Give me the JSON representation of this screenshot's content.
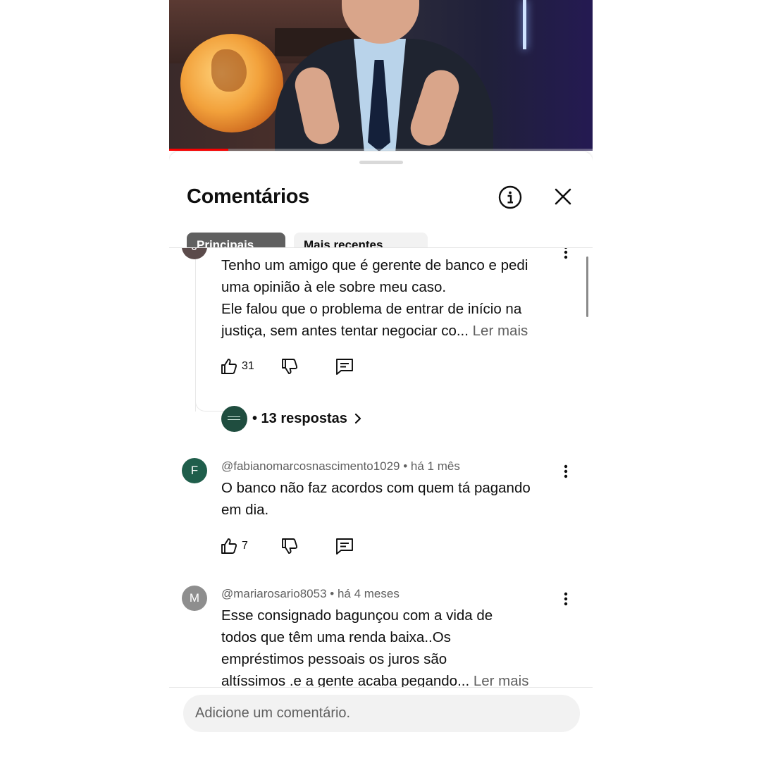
{
  "sheet": {
    "title": "Comentários",
    "info_icon": "info-icon",
    "close_icon": "close-icon"
  },
  "tabs": [
    {
      "label": "Principais",
      "active": true
    },
    {
      "label": "Mais recentes",
      "active": false
    }
  ],
  "comments": [
    {
      "author_initial": "J",
      "text_lines": [
        "Tenho um amigo que é gerente de banco e pedi",
        "uma opinião à ele sobre meu caso.",
        "Ele falou que o problema de entrar de início na",
        "justiça, sem antes tentar negociar co..."
      ],
      "read_more": "Ler mais",
      "likes": "31",
      "replies_label": "• 13 respostas"
    },
    {
      "author_initial": "F",
      "author": "@fabianomarcosnascimento1029",
      "time": "• há 1 mês",
      "text_lines": [
        "O banco não faz acordos com quem tá pagando",
        "em dia."
      ],
      "likes": "7"
    },
    {
      "author_initial": "M",
      "author": "@mariarosario8053",
      "time": "• há 4 meses",
      "text_lines": [
        "Esse consignado  bagunçou  com a vida de",
        "todos  que  têm  uma renda baixa..Os",
        "empréstimos  pessoais  os juros  são",
        "altíssimos .e a gente  acaba  pegando..."
      ],
      "read_more": "Ler mais"
    }
  ],
  "composer": {
    "placeholder": "Adicione um comentário."
  },
  "colors": {
    "text": "#0f0f0f",
    "secondary": "#606060",
    "progress": "#ff0000"
  },
  "video": {
    "progress": 0.14
  }
}
